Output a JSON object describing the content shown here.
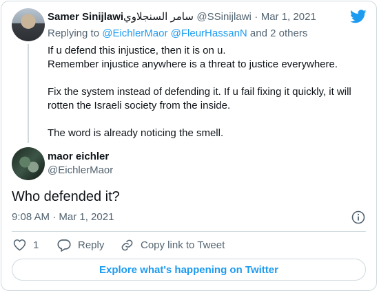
{
  "brand": {
    "icon": "twitter-bird-icon",
    "color": "#1d9bf0"
  },
  "parent_tweet": {
    "author_name": "Samer Sinijlawi",
    "author_name_arabic": "سامر السنجلاوي",
    "handle": "@SSinijlawi",
    "separator": "·",
    "date": "Mar 1, 2021",
    "replying_prefix": "Replying to",
    "replying_to_1": "@EichlerMaor",
    "replying_to_2": "@FleurHassanN",
    "replying_suffix": "and 2 others",
    "text": "If u defend this injustice, then it is on u.\nRemember injustice anywhere is a threat to justice everywhere.\n\nFix the system instead of defending it. If u fail fixing it quickly, it will rotten the Israeli society from the inside.\n\n The word is already noticing the smell."
  },
  "main_tweet": {
    "author_name": "maor eichler",
    "handle": "@EichlerMaor",
    "text": "Who defended it?",
    "timestamp": "9:08 AM · Mar 1, 2021"
  },
  "actions": {
    "like_count": "1",
    "reply_label": "Reply",
    "copy_link_label": "Copy link to Tweet"
  },
  "explore_button_label": "Explore what's happening on Twitter"
}
